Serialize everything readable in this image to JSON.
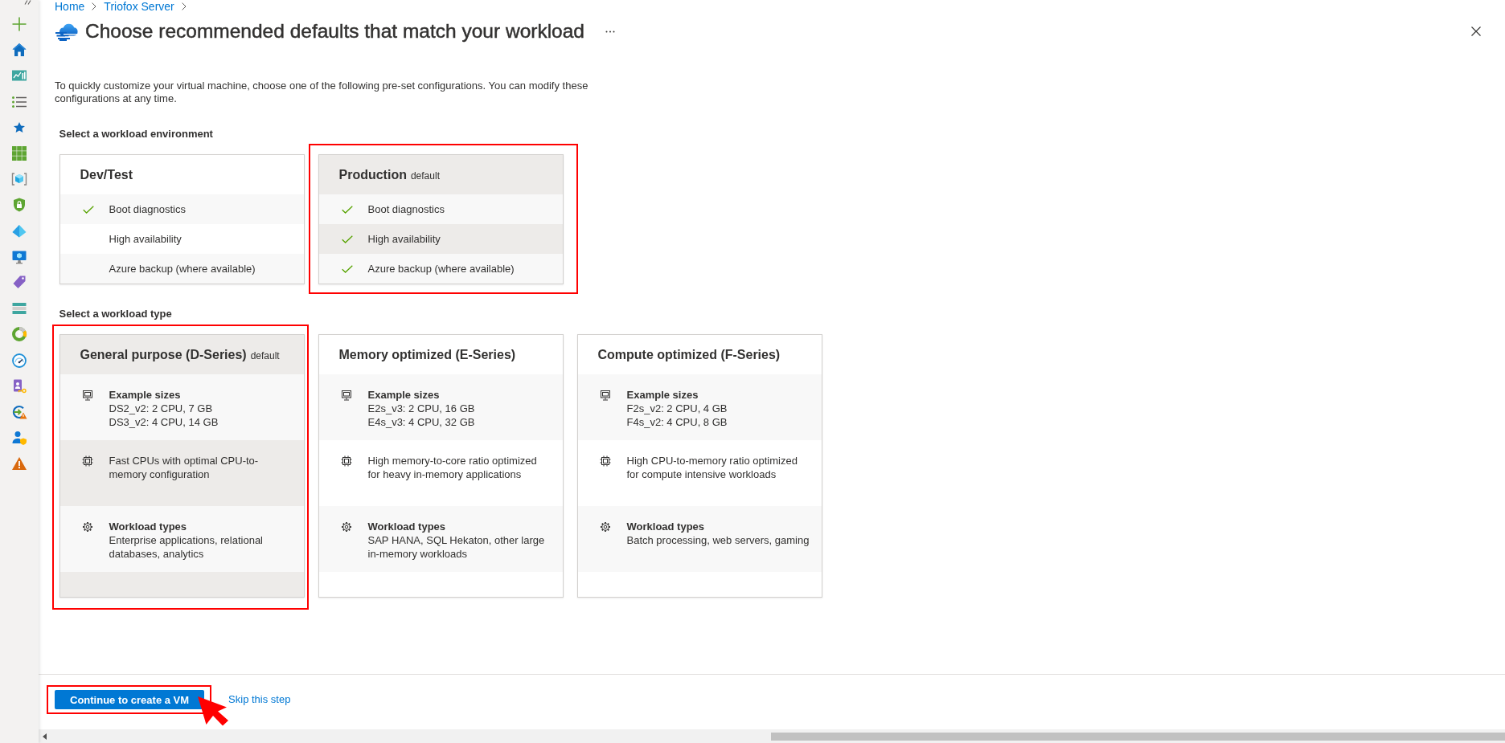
{
  "breadcrumb": [
    {
      "label": "Home"
    },
    {
      "label": "Triofox Server"
    }
  ],
  "blade": {
    "title": "Choose recommended defaults that match your workload"
  },
  "description": "To quickly customize your virtual machine, choose one of the following pre-set configurations. You can modify these configurations at any time.",
  "environment": {
    "heading": "Select a workload environment",
    "options": [
      {
        "title": "Dev/Test",
        "selected": false,
        "highlighted": false,
        "features": [
          {
            "label": "Boot diagnostics",
            "checked": true
          },
          {
            "label": "High availability",
            "checked": false
          },
          {
            "label": "Azure backup (where available)",
            "checked": false
          }
        ]
      },
      {
        "title": "Production",
        "tag": "default",
        "selected": true,
        "highlighted": true,
        "features": [
          {
            "label": "Boot diagnostics",
            "checked": true
          },
          {
            "label": "High availability",
            "checked": true
          },
          {
            "label": "Azure backup (where available)",
            "checked": true
          }
        ]
      }
    ]
  },
  "workload_type": {
    "heading": "Select a workload type",
    "options": [
      {
        "title": "General purpose (D-Series)",
        "tag": "default",
        "selected": true,
        "highlighted": true,
        "sections": [
          {
            "kind": "sizes",
            "heading": "Example sizes",
            "lines": [
              "DS2_v2: 2 CPU, 7 GB",
              "DS3_v2: 4 CPU, 14 GB"
            ]
          },
          {
            "kind": "processor",
            "text": "Fast CPUs with optimal CPU-to-memory configuration"
          },
          {
            "kind": "workloads",
            "heading": "Workload types",
            "text": "Enterprise applications, relational databases, analytics"
          }
        ]
      },
      {
        "title": "Memory optimized (E-Series)",
        "selected": false,
        "highlighted": false,
        "sections": [
          {
            "kind": "sizes",
            "heading": "Example sizes",
            "lines": [
              "E2s_v3: 2 CPU, 16 GB",
              "E4s_v3: 4 CPU, 32 GB"
            ]
          },
          {
            "kind": "processor",
            "text": "High memory-to-core ratio optimized for heavy in-memory applications"
          },
          {
            "kind": "workloads",
            "heading": "Workload types",
            "text": "SAP HANA, SQL Hekaton, other large in-memory workloads"
          }
        ]
      },
      {
        "title": "Compute optimized (F-Series)",
        "selected": false,
        "highlighted": false,
        "sections": [
          {
            "kind": "sizes",
            "heading": "Example sizes",
            "lines": [
              "F2s_v2: 2 CPU, 4 GB",
              "F4s_v2: 4 CPU, 8 GB"
            ]
          },
          {
            "kind": "processor",
            "text": "High CPU-to-memory ratio optimized for compute intensive workloads"
          },
          {
            "kind": "workloads",
            "heading": "Workload types",
            "text": "Batch processing, web servers, gaming"
          }
        ]
      }
    ]
  },
  "footer": {
    "primary_button": {
      "label": "Continue to create a VM",
      "highlighted": true,
      "pointed_at": true
    },
    "link": "Skip this step"
  }
}
